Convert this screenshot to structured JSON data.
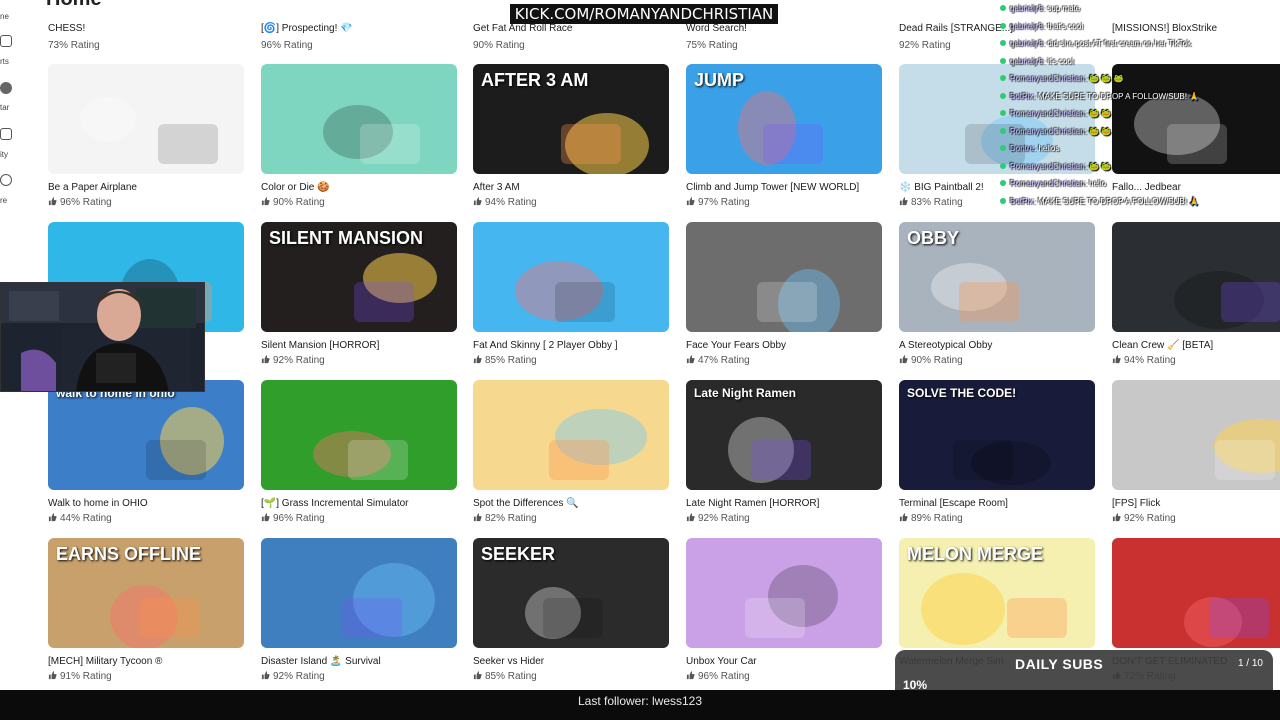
{
  "page": {
    "title": "Home"
  },
  "sidebar": {
    "items": [
      {
        "label": "ne"
      },
      {
        "label": "rts"
      },
      {
        "label": "tar"
      },
      {
        "label": "ity"
      },
      {
        "label": "re"
      }
    ]
  },
  "overlays": {
    "kick_banner": "KICK.COM/ROMANYANDCHRISTIAN",
    "chat": [
      {
        "user": "gabrieljr8",
        "message": ": sup mate"
      },
      {
        "user": "gabrieljr8",
        "message": ": that's cool"
      },
      {
        "user": "gabrieljr8",
        "message": ": did she post AT first cream on her TikTok"
      },
      {
        "user": "gabrieljr8",
        "message": ": it's cool"
      },
      {
        "user": "RomanyandChristian",
        "message": ": 🐸 🐸 🐸"
      },
      {
        "user": "BotRix",
        "message": ": MAKE SURE TO DROP A FOLLOW/SUB! 🙏"
      },
      {
        "user": "RomanyandChristian",
        "message": ": 🐸 🐸"
      },
      {
        "user": "RomanyandChristian",
        "message": ": 🐸 🐸"
      },
      {
        "user": "Dontre",
        "message": ": hellos"
      },
      {
        "user": "RomanyandChristian",
        "message": ": 🐸 🐸"
      },
      {
        "user": "RomanyandChristian",
        "message": ": hello"
      },
      {
        "user": "BotRix",
        "message": ": MAKE SURE TO DROP A FOLLOW/SUB! 🙏"
      }
    ],
    "daily_subs": {
      "title": "DAILY SUBS",
      "count": "1 / 10",
      "percent_label": "10%",
      "progress": 0.1
    },
    "last_follower": "Last follower: lwess123"
  },
  "colors": {
    "accent_green": "#7cff7c",
    "chat_user": "#c9b8ff"
  },
  "games_row0": [
    {
      "name": "CHESS!",
      "rating": "73% Rating"
    },
    {
      "name": "[🌀] Prospecting! 💎",
      "rating": "96% Rating"
    },
    {
      "name": "Get Fat And Roll Race",
      "rating": "90% Rating"
    },
    {
      "name": "Word Search!",
      "rating": "75% Rating"
    },
    {
      "name": "Dead Rails [STRANGE...]",
      "rating": "92% Rating"
    },
    {
      "name": "[MISSIONS!] BloxStrike",
      "rating": ""
    }
  ],
  "games": [
    {
      "name": "Be a Paper Airplane",
      "rating": "96% Rating",
      "caption": ""
    },
    {
      "name": "Color or Die 🍪",
      "rating": "90% Rating",
      "caption": ""
    },
    {
      "name": "After 3 AM",
      "rating": "94% Rating",
      "caption": "AFTER 3 AM"
    },
    {
      "name": "Climb and Jump Tower [NEW WORLD]",
      "rating": "97% Rating",
      "caption": "JUMP"
    },
    {
      "name": "❄️ BIG Paintball 2!",
      "rating": "83% Rating",
      "caption": ""
    },
    {
      "name": "Fallo... Jedbear",
      "rating": "",
      "caption": ""
    },
    {
      "name": "",
      "rating": "",
      "caption": ""
    },
    {
      "name": "Silent Mansion [HORROR]",
      "rating": "92% Rating",
      "caption": "SILENT MANSION"
    },
    {
      "name": "Fat And Skinny [ 2 Player Obby ]",
      "rating": "85% Rating",
      "caption": ""
    },
    {
      "name": "Face Your Fears Obby",
      "rating": "47% Rating",
      "caption": ""
    },
    {
      "name": "A Stereotypical Obby",
      "rating": "90% Rating",
      "caption": "OBBY"
    },
    {
      "name": "Clean Crew 🧹 [BETA]",
      "rating": "94% Rating",
      "caption": ""
    },
    {
      "name": "Walk to home in OHIO",
      "rating": "44% Rating",
      "caption": "walk to home in ohio"
    },
    {
      "name": "[🌱] Grass Incremental Simulator",
      "rating": "96% Rating",
      "caption": ""
    },
    {
      "name": "Spot the Differences 🔍",
      "rating": "82% Rating",
      "caption": ""
    },
    {
      "name": "Late Night Ramen [HORROR]",
      "rating": "92% Rating",
      "caption": "Late Night Ramen"
    },
    {
      "name": "Terminal [Escape Room]",
      "rating": "89% Rating",
      "caption": "SOLVE THE CODE!"
    },
    {
      "name": "[FPS] Flick",
      "rating": "92% Rating",
      "caption": ""
    },
    {
      "name": "[MECH] Military Tycoon ®",
      "rating": "91% Rating",
      "caption": "EARNS OFFLINE"
    },
    {
      "name": "Disaster Island 🏝️ Survival",
      "rating": "92% Rating",
      "caption": ""
    },
    {
      "name": "Seeker vs Hider",
      "rating": "85% Rating",
      "caption": "SEEKER"
    },
    {
      "name": "Unbox Your Car",
      "rating": "96% Rating",
      "caption": ""
    },
    {
      "name": "Watermelon Merge Sim",
      "rating": "",
      "caption": "MELON MERGE"
    },
    {
      "name": "DON'T GET ELIMINATED",
      "rating": "72% Rating",
      "caption": ""
    }
  ],
  "thumb_colors": [
    "#f4f4f4",
    "#7fd6c0",
    "#1c1c1c",
    "#3aa0e8",
    "#c5dde8",
    "#121212",
    "#2fb7e8",
    "#231f1f",
    "#46b6f0",
    "#6d6d6d",
    "#a9b3bd",
    "#2b2f33",
    "#3d7ec9",
    "#2f9e2a",
    "#f6d98e",
    "#2a2a2a",
    "#181c3a",
    "#c8c8c8",
    "#c8a06b",
    "#3f7fbf",
    "#2b2b2b",
    "#caa0e6",
    "#f5f0b0",
    "#c93030"
  ]
}
